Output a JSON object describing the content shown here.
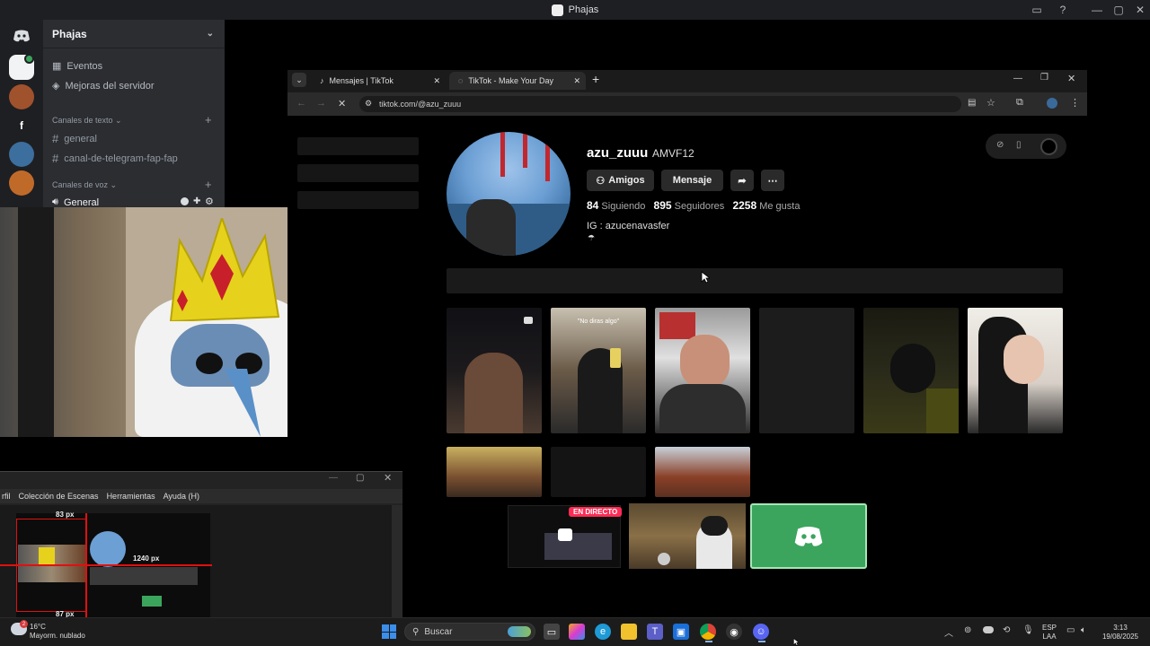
{
  "titlebar": {
    "title": "Phajas"
  },
  "discord": {
    "server_name": "Phajas",
    "items": {
      "events": "Eventos",
      "boosts": "Mejoras del servidor"
    },
    "text_category": "Canales de texto",
    "text_channels": [
      "general",
      "canal-de-telegram-fap-fap"
    ],
    "voice_category": "Canales de voz",
    "voice_channel": "General",
    "rail_letter": "f"
  },
  "browser": {
    "tabs": [
      "Mensajes | TikTok",
      "TikTok - Make Your Day"
    ],
    "url": "tiktok.com/@azu_zuuu"
  },
  "profile": {
    "username": "azu_zuuu",
    "nickname": "AMVF12",
    "friends_button": "Amigos",
    "message_button": "Mensaje",
    "following_count": "84",
    "following_label": "Siguiendo",
    "followers_count": "895",
    "followers_label": "Seguidores",
    "likes_count": "2258",
    "likes_label": "Me gusta",
    "bio": "IG : azucenavasfer",
    "thumb_caption": "\"No diras algo\""
  },
  "stream": {
    "live_badge": "EN DIRECTO"
  },
  "obs": {
    "menu": [
      "rfil",
      "Colección de Escenas",
      "Herramientas",
      "Ayuda (H)"
    ],
    "measure_top": "83 px",
    "measure_mid": "1240 px",
    "measure_bottom": "87 px"
  },
  "taskbar": {
    "weather_temp": "16°C",
    "weather_desc": "Mayorm. nublado",
    "weather_badge": "2",
    "search_placeholder": "Buscar",
    "lang_line1": "ESP",
    "lang_line2": "LAA",
    "time": "3:13",
    "date": "19/08/2025"
  },
  "colors": {
    "discord_green": "#3ba55d",
    "live_red": "#fe2c55",
    "windows_blue": "#3b8eea"
  }
}
